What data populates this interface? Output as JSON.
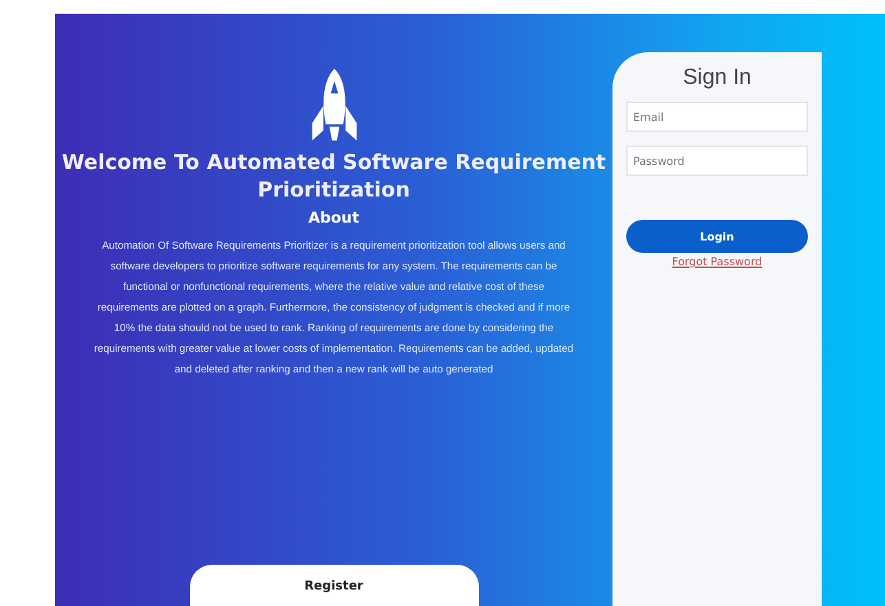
{
  "hero": {
    "title": "Welcome To Automated Software Requirement Prioritization",
    "about_heading": "About",
    "about_text": "Automation Of Software Requirements Prioritizer is a requirement prioritization tool allows users and software developers to prioritize software requirements for any system. The requirements can be functional or nonfunctional requirements, where the relative value and relative cost of these requirements are plotted on a graph. Furthermore, the consistency of judgment is checked and if more 10% the data should not be used to rank. Ranking of requirements are done by considering the requirements with greater value at lower costs of implementation. Requirements can be added, updated and deleted after ranking and then a new rank will be auto generated",
    "register_button": "Register"
  },
  "sign_in": {
    "title": "Sign In",
    "email": {
      "placeholder": "Email"
    },
    "password": {
      "placeholder": "Password"
    },
    "login_button": "Login",
    "forgot_link": "Forgot Password"
  }
}
